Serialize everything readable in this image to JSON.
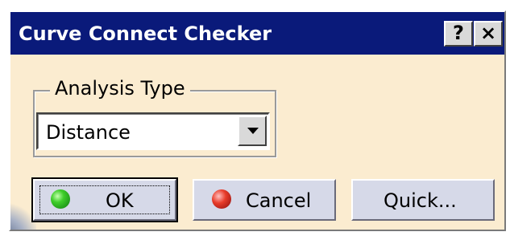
{
  "window": {
    "title": "Curve Connect Checker",
    "help_button": "?",
    "close_button": "×"
  },
  "analysis_type": {
    "group_label": "Analysis Type",
    "selected": "Distance"
  },
  "buttons": {
    "ok": "OK",
    "cancel": "Cancel",
    "quick": "Quick..."
  },
  "colors": {
    "titlebar": "#0a1a7a",
    "dialog_background": "#fbecd0",
    "button_face": "#d6d9e8",
    "ok_indicator": "#3fce2a",
    "cancel_indicator": "#e83c2a"
  },
  "icons": {
    "ok": "green-led-icon",
    "cancel": "red-led-icon",
    "dropdown": "chevron-down-icon"
  }
}
